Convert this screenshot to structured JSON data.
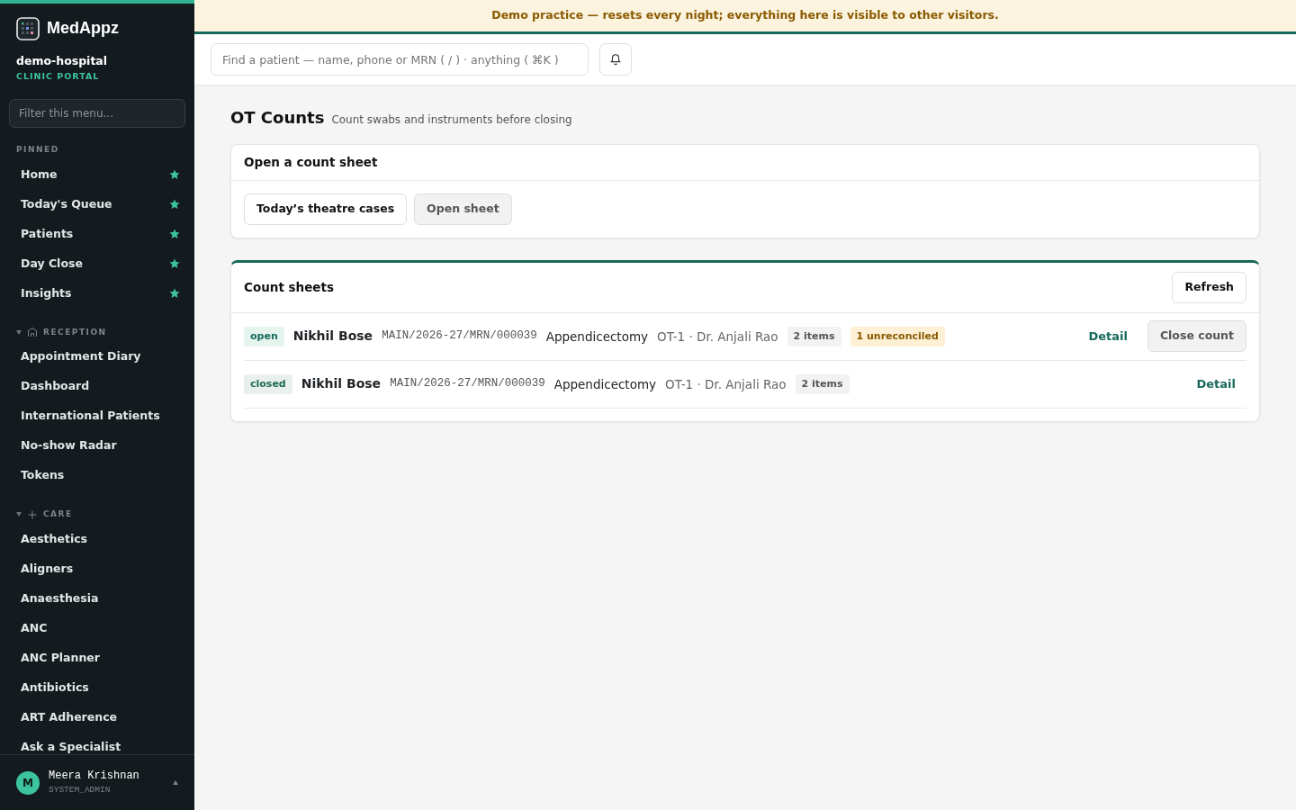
{
  "brand": {
    "name": "MedAppz",
    "org": "demo-hospital",
    "portal": "CLINIC PORTAL"
  },
  "sidebar": {
    "filter_placeholder": "Filter this menu...",
    "pinned_label": "PINNED",
    "pinned": [
      {
        "label": "Home",
        "starred": true
      },
      {
        "label": "Today's Queue",
        "starred": true
      },
      {
        "label": "Patients",
        "starred": true
      },
      {
        "label": "Day Close",
        "starred": true
      },
      {
        "label": "Insights",
        "starred": true
      }
    ],
    "sections": [
      {
        "label": "RECEPTION",
        "expanded": true,
        "items": [
          "Appointment Diary",
          "Dashboard",
          "International Patients",
          "No-show Radar",
          "Tokens"
        ]
      },
      {
        "label": "CARE",
        "expanded": true,
        "items": [
          "Aesthetics",
          "Aligners",
          "Anaesthesia",
          "ANC",
          "ANC Planner",
          "Antibiotics",
          "ART Adherence",
          "Ask a Specialist"
        ]
      }
    ],
    "user": {
      "initial": "M",
      "name": "Meera Krishnan",
      "role": "SYSTEM_ADMIN"
    }
  },
  "banner": "Demo practice — resets every night; everything here is visible to other visitors.",
  "search": {
    "placeholder": "Find a patient — name, phone or MRN ( / ) · anything ( ⌘K )"
  },
  "page": {
    "title": "OT Counts",
    "subtitle": "Count swabs and instruments before closing"
  },
  "open_card": {
    "title": "Open a count sheet",
    "buttons": [
      {
        "label": "Today’s theatre cases",
        "disabled": false
      },
      {
        "label": "Open sheet",
        "disabled": true
      }
    ]
  },
  "sheets_card": {
    "title": "Count sheets",
    "refresh": "Refresh",
    "rows": [
      {
        "status": "open",
        "patient": "Nikhil Bose",
        "mrn": "MAIN/2026-27/MRN/000039",
        "procedure": "Appendicectomy",
        "theatre": "OT-1 · Dr. Anjali Rao",
        "items": "2 items",
        "warning": "1 unreconciled",
        "detail": "Detail",
        "close": {
          "label": "Close count",
          "disabled": true
        }
      },
      {
        "status": "closed",
        "patient": "Nikhil Bose",
        "mrn": "MAIN/2026-27/MRN/000039",
        "procedure": "Appendicectomy",
        "theatre": "OT-1 · Dr. Anjali Rao",
        "items": "2 items",
        "detail": "Detail"
      }
    ]
  }
}
